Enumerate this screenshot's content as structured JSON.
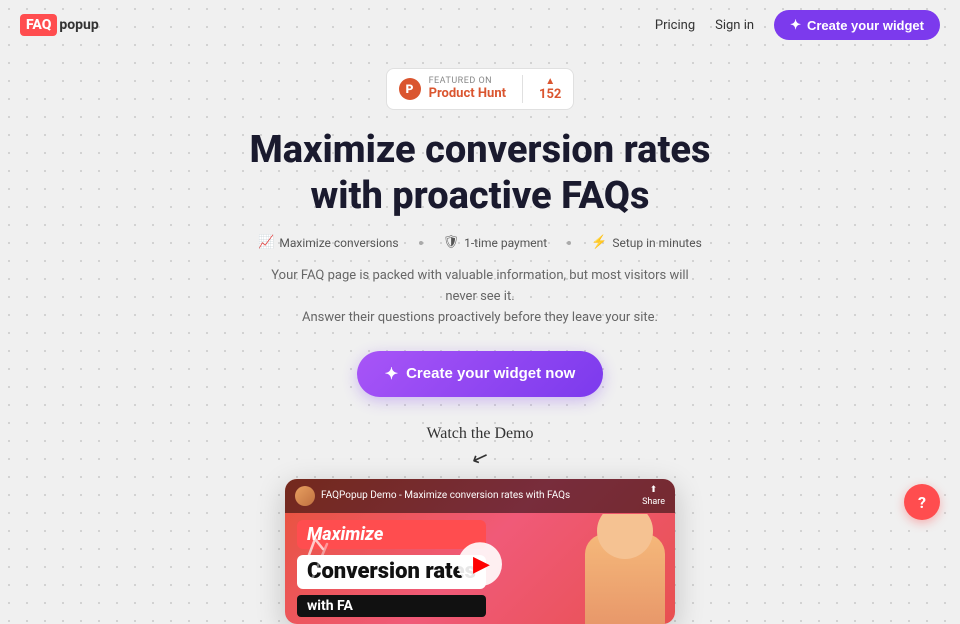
{
  "nav": {
    "logo_faq": "FAQ",
    "logo_popup": "popup",
    "pricing_label": "Pricing",
    "signin_label": "Sign in",
    "cta_label": "Create your widget",
    "cta_icon": "✦"
  },
  "product_hunt": {
    "featured_text": "FEATURED ON",
    "name": "Product Hunt",
    "count": "152",
    "arrow": "▲"
  },
  "hero": {
    "headline_line1": "Maximize conversion rates",
    "headline_line2": "with proactive FAQs",
    "feature1_icon": "📈",
    "feature1_text": "Maximize conversions",
    "feature2_icon": "🛡",
    "feature2_text": "1-time payment",
    "feature3_icon": "⚡",
    "feature3_text": "Setup in minutes",
    "subtitle_line1": "Your FAQ page is packed with valuable information, but most visitors will never see it.",
    "subtitle_line2": "Answer their questions proactively before they leave your site.",
    "cta_label": "Create your widget now",
    "cta_icon": "✦"
  },
  "demo": {
    "watch_label": "Watch the Demo",
    "video_title": "FAQPopup Demo - Maximize conversion rates with FAQs",
    "share_label": "Share",
    "tag_maximize": "Maximize",
    "tag_conversion": "Conversion rates",
    "tag_faq": "with FA",
    "share_icon": "⬆"
  },
  "help": {
    "label": "?"
  }
}
